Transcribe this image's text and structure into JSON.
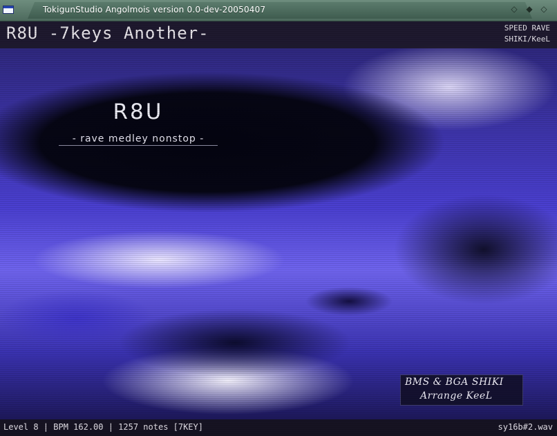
{
  "window": {
    "title": "TokigunStudio Angolmois version 0.0-dev-20050407",
    "sys_menu_icon": "window-icon",
    "minimize_symbol": "◇",
    "maximize_symbol": "◆",
    "close_symbol": "◇"
  },
  "header": {
    "song_title": "R8U -7keys Another-",
    "genre": "SPEED RAVE",
    "artist": "SHIKI/KeeL"
  },
  "bga": {
    "title": "R8U",
    "subtitle": "- rave medley nonstop -",
    "credit_line1": "BMS & BGA  SHIKI",
    "credit_line2": "Arrange   KeeL"
  },
  "status": {
    "left": "Level 8 | BPM 162.00 | 1257 notes [7KEY]",
    "right": "sy16b#2.wav"
  },
  "colors": {
    "titlebar": "#5b7b6c",
    "sky_blue": "#4a3fd0",
    "cloud_white": "#f0ecff"
  }
}
